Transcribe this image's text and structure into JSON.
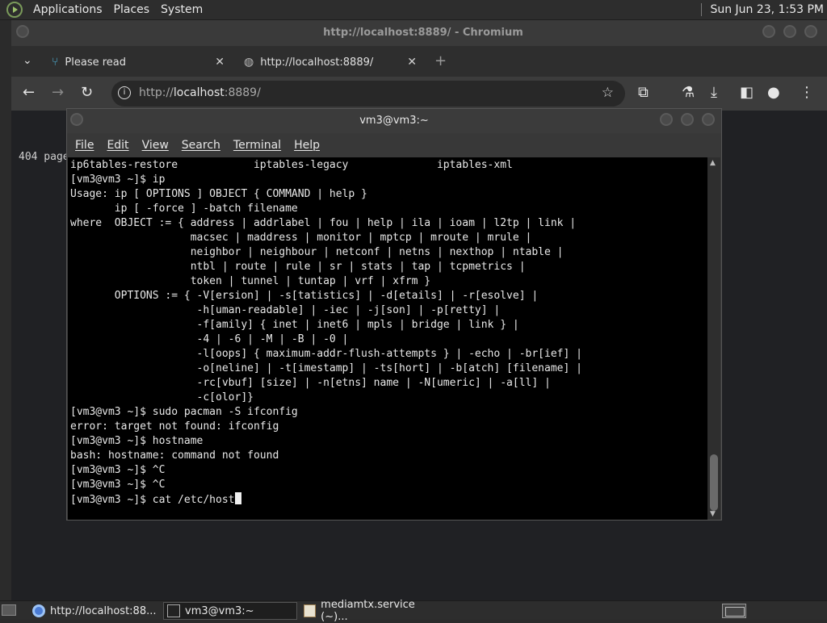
{
  "top_panel": {
    "menus": [
      "Applications",
      "Places",
      "System"
    ],
    "clock": "Sun Jun 23,  1:53 PM"
  },
  "chromium": {
    "window_title": "http://localhost:8889/ - Chromium",
    "tabs": [
      {
        "label": "Please read",
        "icon": "branch-icon"
      },
      {
        "label": "http://localhost:8889/",
        "icon": "globe-icon"
      }
    ],
    "omnibox": {
      "url_prefix": "http://",
      "url_host": "localhost",
      "url_rest": ":8889/"
    },
    "page_text": "404 page"
  },
  "terminal": {
    "title": "vm3@vm3:~",
    "menu": [
      "File",
      "Edit",
      "View",
      "Search",
      "Terminal",
      "Help"
    ],
    "lines": [
      "ip6tables-restore            iptables-legacy              iptables-xml",
      "[vm3@vm3 ~]$ ip",
      "Usage: ip [ OPTIONS ] OBJECT { COMMAND | help }",
      "       ip [ -force ] -batch filename",
      "where  OBJECT := { address | addrlabel | fou | help | ila | ioam | l2tp | link |",
      "                   macsec | maddress | monitor | mptcp | mroute | mrule |",
      "                   neighbor | neighbour | netconf | netns | nexthop | ntable |",
      "                   ntbl | route | rule | sr | stats | tap | tcpmetrics |",
      "                   token | tunnel | tuntap | vrf | xfrm }",
      "       OPTIONS := { -V[ersion] | -s[tatistics] | -d[etails] | -r[esolve] |",
      "                    -h[uman-readable] | -iec | -j[son] | -p[retty] |",
      "                    -f[amily] { inet | inet6 | mpls | bridge | link } |",
      "                    -4 | -6 | -M | -B | -0 |",
      "                    -l[oops] { maximum-addr-flush-attempts } | -echo | -br[ief] |",
      "                    -o[neline] | -t[imestamp] | -ts[hort] | -b[atch] [filename] |",
      "                    -rc[vbuf] [size] | -n[etns] name | -N[umeric] | -a[ll] |",
      "                    -c[olor]}",
      "[vm3@vm3 ~]$ sudo pacman -S ifconfig",
      "error: target not found: ifconfig",
      "[vm3@vm3 ~]$ hostname",
      "bash: hostname: command not found",
      "[vm3@vm3 ~]$ ^C",
      "[vm3@vm3 ~]$ ^C"
    ],
    "prompt_line": "[vm3@vm3 ~]$ cat /etc/host"
  },
  "taskbar": {
    "items": [
      {
        "label": "http://localhost:88...",
        "icon": "chromium-icon"
      },
      {
        "label": "vm3@vm3:~",
        "icon": "terminal-icon"
      },
      {
        "label": "mediamtx.service (~)...",
        "icon": "text-editor-icon"
      }
    ]
  }
}
